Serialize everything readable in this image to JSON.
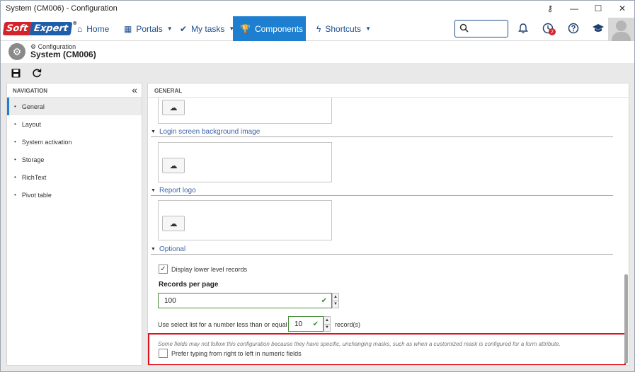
{
  "window": {
    "title": "System (CM006) - Configuration",
    "controls": [
      "key-icon",
      "minimize-icon",
      "maximize-icon",
      "close-icon"
    ]
  },
  "navbar": {
    "logo": {
      "part1": "Soft",
      "part2": "Expert",
      "mark": "®"
    },
    "menu": [
      {
        "label": "Home",
        "icon": "home-icon"
      },
      {
        "label": "Portals",
        "icon": "grid-icon"
      },
      {
        "label": "My tasks",
        "icon": "check-icon"
      },
      {
        "label": "Components",
        "icon": "trophy-icon",
        "active": true
      },
      {
        "label": "Shortcuts",
        "icon": "bolt-icon"
      }
    ],
    "search_placeholder": "",
    "notifications_badge": "2",
    "accent_color": "#1e7fd0"
  },
  "header": {
    "subtitle": "Configuration",
    "title": "System (CM006)"
  },
  "toolbar": {
    "save": "save-icon",
    "refresh": "refresh-icon"
  },
  "navigation": {
    "heading": "NAVIGATION",
    "items": [
      "General",
      "Layout",
      "System activation",
      "Storage",
      "RichText",
      "Pivot table"
    ],
    "selected": "General"
  },
  "main": {
    "heading": "GENERAL",
    "sections": [
      {
        "label": "Login screen background image"
      },
      {
        "label": "Report logo"
      },
      {
        "label": "Optional"
      }
    ],
    "display_lower_level": {
      "label": "Display lower level records",
      "checked": true
    },
    "records_per_page": {
      "label": "Records per page",
      "value": "100"
    },
    "select_list": {
      "prefix": "Use select list for a number less than or equal to",
      "value": "10",
      "suffix": "record(s)"
    },
    "note": "Some fields may not follow this configuration because they have specific, unchanging masks, such as when a customized mask is configured for a form attribute.",
    "prefer_rtl": {
      "label": "Prefer typing from right to left in numeric fields",
      "checked": false
    },
    "highlight_color": "#e0101e"
  }
}
